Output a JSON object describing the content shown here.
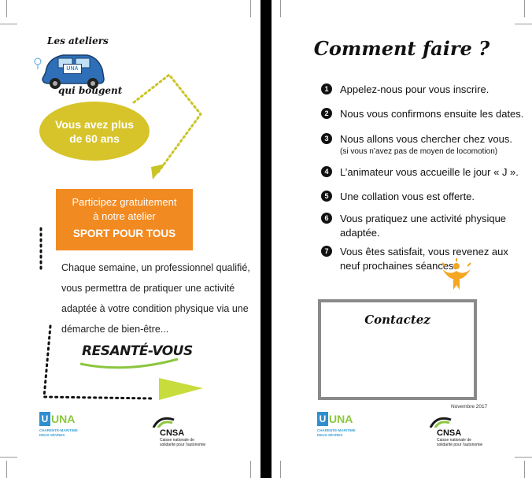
{
  "left_panel": {
    "header_top": "Les ateliers",
    "header_bottom": "qui bougent",
    "car_badge": "UNA",
    "oval": {
      "line1": "Vous avez plus",
      "line2": "de 60 ans"
    },
    "orange_box": {
      "line1": "Participez gratuitement",
      "line2": "à notre atelier",
      "line3": "SPORT POUR TOUS"
    },
    "body_lines": [
      "Chaque semaine, un professionnel qualifié,",
      "vous permettra de pratiquer une activité",
      "adaptée à votre condition physique via une",
      "démarche de bien-être..."
    ],
    "resante_logo": "RESANTÉ-VOUS",
    "una_logo": {
      "text": "UNA",
      "sub1": "CHARENTE-MARITIME",
      "sub2": "DEUX-SÈVRES"
    },
    "cnsa_logo": {
      "text": "CNSA",
      "sub1": "Caisse nationale de",
      "sub2": "solidarité pour l'autonomie"
    }
  },
  "right_panel": {
    "title": "Comment faire ?",
    "steps": [
      {
        "num": "1",
        "text": "Appelez-nous pour vous inscrire."
      },
      {
        "num": "2",
        "text": "Nous vous confirmons ensuite les dates."
      },
      {
        "num": "3",
        "text": "Nous allons vous chercher chez vous.",
        "note": "(si vous n’avez pas de moyen de locomotion)"
      },
      {
        "num": "4",
        "text": "L’animateur vous accueille le jour « J »."
      },
      {
        "num": "5",
        "text": "Une collation vous est offerte."
      },
      {
        "num": "6",
        "text": "Vous pratiquez une activité physique",
        "text2": "adaptée."
      },
      {
        "num": "7",
        "text": "Vous êtes satisfait, vous revenez aux",
        "text2": "neuf prochaines séances."
      }
    ],
    "contact_title": "Contactez",
    "date_note": "Novembre 2017",
    "una_logo": {
      "text": "UNA",
      "sub1": "CHARENTE-MARITIME",
      "sub2": "DEUX-SÈVRES"
    },
    "cnsa_logo": {
      "text": "CNSA",
      "sub1": "Caisse nationale de",
      "sub2": "solidarité pour l'autonomie"
    }
  },
  "colors": {
    "oval_yellow": "#d7c42a",
    "orange": "#f28a22",
    "arrow_green": "#c8dc3c",
    "una_blue": "#2e8fd0",
    "una_green": "#8cc63f",
    "person_orange": "#f5a623"
  }
}
